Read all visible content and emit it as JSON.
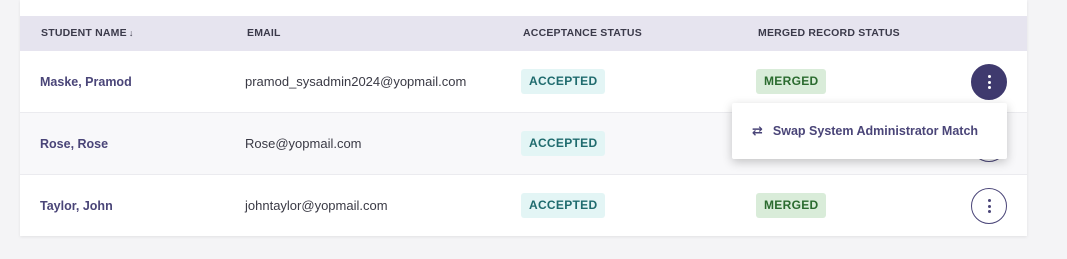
{
  "table": {
    "headers": {
      "student_name": "STUDENT NAME",
      "sort_icon": "↓",
      "email": "EMAIL",
      "acceptance_status": "ACCEPTANCE STATUS",
      "merged_record_status": "MERGED RECORD STATUS"
    },
    "rows": [
      {
        "name": "Maske, Pramod",
        "email": "pramod_sysadmin2024@yopmail.com",
        "acceptance": "ACCEPTED",
        "merged": "MERGED"
      },
      {
        "name": "Rose, Rose",
        "email": "Rose@yopmail.com",
        "acceptance": "ACCEPTED",
        "merged": ""
      },
      {
        "name": "Taylor, John",
        "email": "johntaylor@yopmail.com",
        "acceptance": "ACCEPTED",
        "merged": "MERGED"
      }
    ]
  },
  "menu": {
    "icon": "arrows-swap-icon",
    "icon_glyph": "⇄",
    "item_label": "Swap System Administrator Match"
  },
  "colors": {
    "accent": "#4a4578",
    "header_bg": "#e6e4ef",
    "accepted_bg": "#e3f5f5",
    "merged_bg": "#d9ecd9"
  }
}
